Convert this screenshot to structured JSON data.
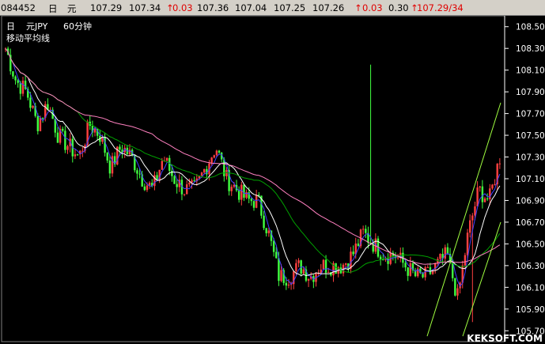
{
  "quote_bar": {
    "code": "084452",
    "day": "日",
    "name": "元",
    "v1": "107.29",
    "v2": "107.34",
    "chg_arrow": "↑",
    "chg": "0.03",
    "v3": "107.36",
    "v4": "107.04",
    "v5": "107.25",
    "v6": "107.26",
    "chg2_arrow": "↑",
    "chg2": "0.03",
    "v7": "0.30",
    "tail_arrow": "↑",
    "tail": "107.29/34"
  },
  "chart_header": {
    "period": "日",
    "symbol": "元JPY",
    "interval": "60分钟",
    "indicator": "移动平均线"
  },
  "watermark": "KEKSOFT.COM",
  "colors": {
    "background": "#000000",
    "up": "#ff4040",
    "down": "#40ff40",
    "ma_short": "#4040ff",
    "ma_mid": "#ffffff",
    "ma_long": "#00a000",
    "ma_longest": "#ff80c0",
    "trendline": "#a0ff40",
    "axis": "#ffffff"
  },
  "chart_data": {
    "type": "candlestick",
    "ylim": [
      105.6,
      108.6
    ],
    "y_ticks": [
      108.5,
      108.3,
      108.1,
      107.9,
      107.7,
      107.5,
      107.3,
      107.1,
      106.9,
      106.7,
      106.5,
      106.3,
      106.1,
      105.9,
      105.7
    ],
    "close_path": [
      108.3,
      108.0,
      107.9,
      107.6,
      107.8,
      107.5,
      107.4,
      107.3,
      107.6,
      107.5,
      107.2,
      107.4,
      107.3,
      107.1,
      107.0,
      107.3,
      107.1,
      107.0,
      107.0,
      107.2,
      107.4,
      107.1,
      107.0,
      106.9,
      106.9,
      106.6,
      106.2,
      106.2,
      106.3,
      106.2,
      106.3,
      106.3,
      106.3,
      106.4,
      106.6,
      106.5,
      106.4,
      106.4,
      106.3,
      106.2,
      106.2,
      106.3,
      106.4,
      106.0,
      106.6,
      107.0,
      106.9,
      107.3
    ]
  }
}
